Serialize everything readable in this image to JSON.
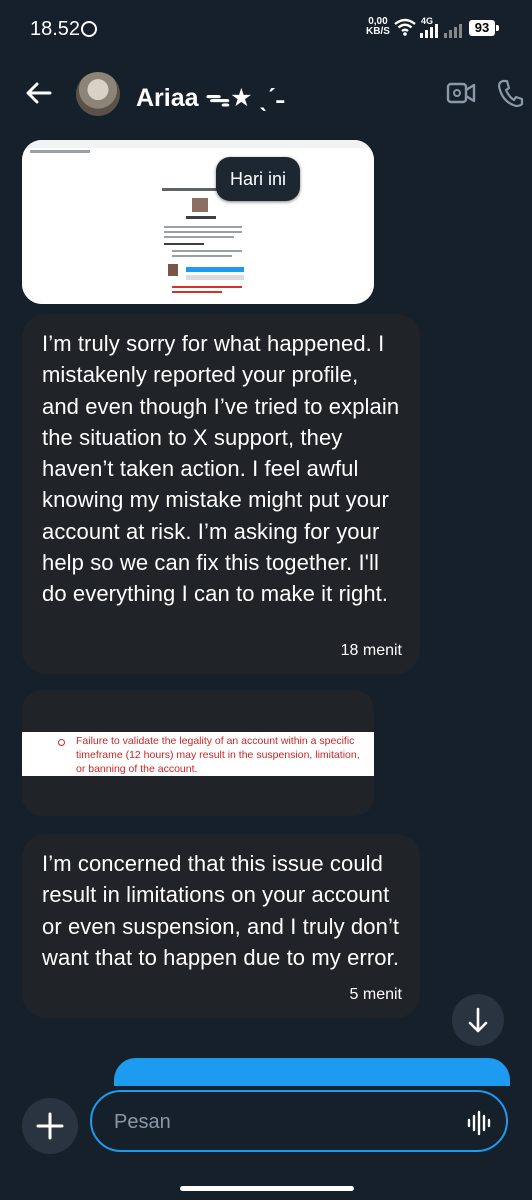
{
  "status_bar": {
    "time": "18.52",
    "speed_value": "0,00",
    "speed_unit": "KB/S",
    "network": "4G",
    "battery": "93"
  },
  "header": {
    "contact_name": "Ariaa ᯓ★ ˎˊ˗"
  },
  "messages": {
    "date_divider": "Hari ini",
    "msg1_text": "I’m truly sorry for what happened. I mistakenly reported your profile, and even though I’ve tried to explain the situation to X support, they haven’t taken action. I feel awful knowing my mistake might put your account at risk. I’m asking for your help so we can fix this together. I'll do everything I can to make it right.",
    "msg1_time": "18 menit",
    "image2_text": "Failure to validate the legality of an account within a specific timeframe (12 hours) may result in the suspension, limitation, or banning of the account.",
    "msg2_text": "I’m concerned that this issue could result in limitations on your account or even suspension, and I truly don’t want that to happen due to my error.",
    "msg2_time": "5 menit"
  },
  "composer": {
    "placeholder": "Pesan"
  },
  "colors": {
    "background": "#15202b",
    "bubble": "#202327",
    "accent": "#1d9bf0"
  },
  "icons": [
    "back-arrow-icon",
    "video-call-icon",
    "phone-icon",
    "arrow-down-icon",
    "plus-icon",
    "voice-wave-icon",
    "wifi-icon",
    "signal-icon"
  ]
}
